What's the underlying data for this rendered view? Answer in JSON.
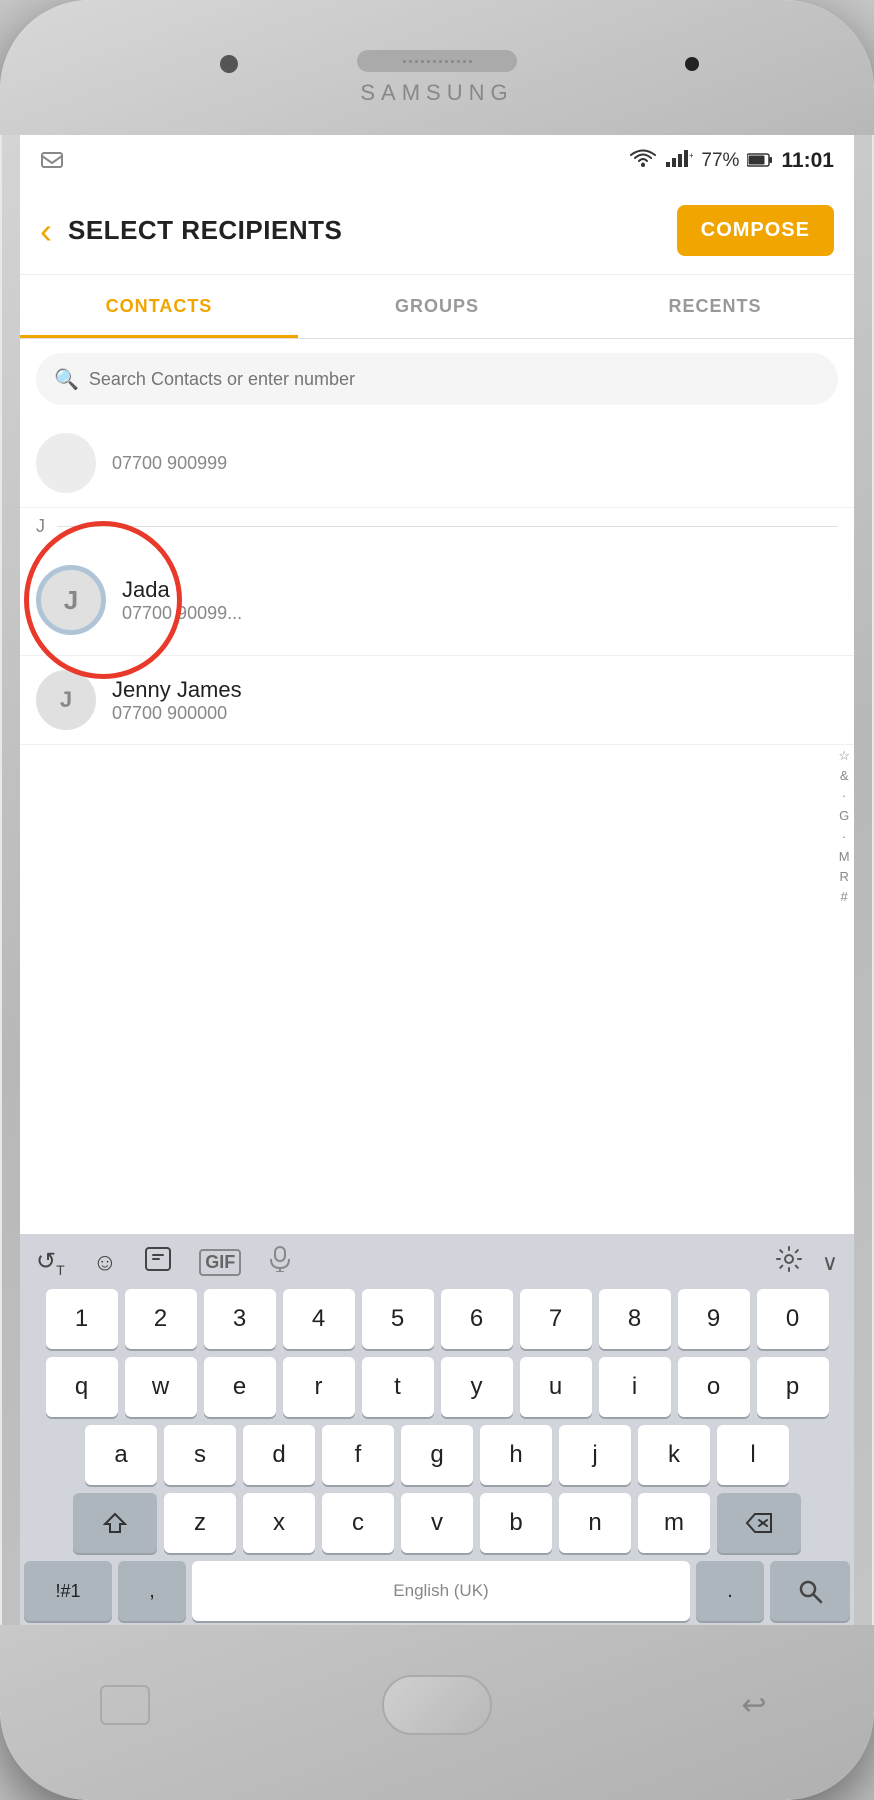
{
  "device": {
    "brand": "SAMSUNG"
  },
  "statusBar": {
    "battery": "77%",
    "time": "11:01"
  },
  "header": {
    "title": "SELECT RECIPIENTS",
    "backLabel": "‹",
    "composeLabel": "COMPOSE"
  },
  "tabs": [
    {
      "id": "contacts",
      "label": "CONTACTS",
      "active": true
    },
    {
      "id": "groups",
      "label": "GROUPS",
      "active": false
    },
    {
      "id": "recents",
      "label": "RECENTS",
      "active": false
    }
  ],
  "search": {
    "placeholder": "Search Contacts or enter number"
  },
  "contacts": {
    "partial": {
      "initial": "",
      "phone": "07700 900999"
    },
    "sectionJ": "J",
    "jada": {
      "initial": "J",
      "name": "Jada",
      "phone": "07700 90099..."
    },
    "jenny": {
      "initial": "J",
      "name": "Jenny James",
      "phone": "07700 900000"
    }
  },
  "alphaIndex": [
    "☆",
    "&",
    "·",
    "G",
    "·",
    "M",
    "R",
    "#"
  ],
  "keyboard": {
    "toolbar": {
      "translate": "↺T",
      "emoji": "☺",
      "sticker": "🗒",
      "gif": "GIF",
      "mic": "🎤",
      "settings": "⚙",
      "collapse": "∨"
    },
    "rows": {
      "numbers": [
        "1",
        "2",
        "3",
        "4",
        "5",
        "6",
        "7",
        "8",
        "9",
        "0"
      ],
      "qwerty": [
        "q",
        "w",
        "e",
        "r",
        "t",
        "y",
        "u",
        "i",
        "o",
        "p"
      ],
      "asdf": [
        "a",
        "s",
        "d",
        "f",
        "g",
        "h",
        "j",
        "k",
        "l"
      ],
      "zxcv": [
        "z",
        "x",
        "c",
        "v",
        "b",
        "n",
        "m"
      ],
      "bottom": {
        "special": "!#1",
        "comma": ",",
        "space": "English (UK)",
        "period": ".",
        "search": "🔍"
      }
    }
  }
}
